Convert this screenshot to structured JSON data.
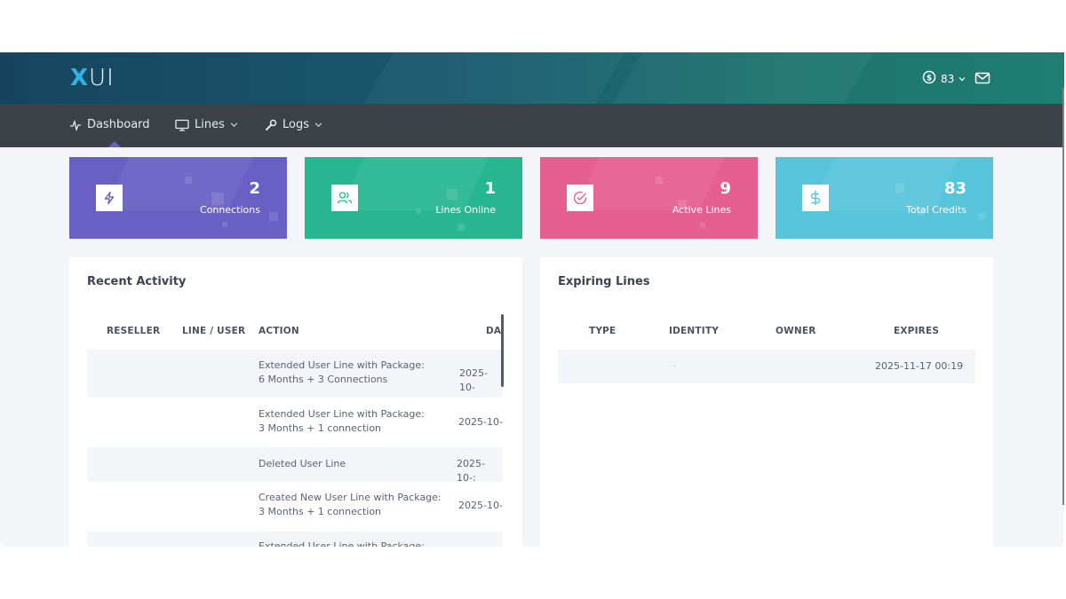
{
  "header": {
    "logo_x": "X",
    "logo_rest": "UI",
    "credits_value": "83",
    "icons": {
      "credits": "dollar-circle-icon",
      "mail": "envelope-icon"
    }
  },
  "nav": {
    "items": [
      {
        "label": "Dashboard",
        "icon": "activity-icon"
      },
      {
        "label": "Lines",
        "icon": "monitor-icon"
      },
      {
        "label": "Logs",
        "icon": "wrench-icon"
      }
    ]
  },
  "stats": [
    {
      "value": "2",
      "label": "Connections",
      "icon": "lightning-icon",
      "color": "#6a5fc4"
    },
    {
      "value": "1",
      "label": "Lines Online",
      "icon": "users-icon",
      "color": "#27b690"
    },
    {
      "value": "9",
      "label": "Active Lines",
      "icon": "check-circle-icon",
      "color": "#e65f91"
    },
    {
      "value": "83",
      "label": "Total Credits",
      "icon": "dollar-icon",
      "color": "#58c4db"
    }
  ],
  "recent_activity": {
    "title": "Recent Activity",
    "columns": [
      "RESELLER",
      "LINE / USER",
      "ACTION",
      "DA"
    ],
    "rows": [
      {
        "reseller": "",
        "line_user": "",
        "action_line1": "Extended User Line with Package:",
        "action_line2": "6 Months + 3 Connections",
        "date": "2025-10-"
      },
      {
        "reseller": "",
        "line_user": "",
        "action_line1": "Extended User Line with Package:",
        "action_line2": "3 Months + 1 connection",
        "date": "2025-10-"
      },
      {
        "reseller": "",
        "line_user": "",
        "action_line1": "Deleted User Line",
        "action_line2": "",
        "date": "2025-10-:"
      },
      {
        "reseller": "",
        "line_user": "",
        "action_line1": "Created New User Line with Package:",
        "action_line2": "3 Months + 1 connection",
        "date": "2025-10-"
      },
      {
        "reseller": "",
        "line_user": "",
        "action_line1": "Extended User Line with Package:",
        "action_line2": "",
        "date": ""
      }
    ]
  },
  "expiring_lines": {
    "title": "Expiring Lines",
    "columns": [
      "TYPE",
      "IDENTITY",
      "OWNER",
      "EXPIRES"
    ],
    "rows": [
      {
        "type": "",
        "identity": "-",
        "owner": "",
        "expires": "2025-11-17 00:19"
      }
    ]
  }
}
